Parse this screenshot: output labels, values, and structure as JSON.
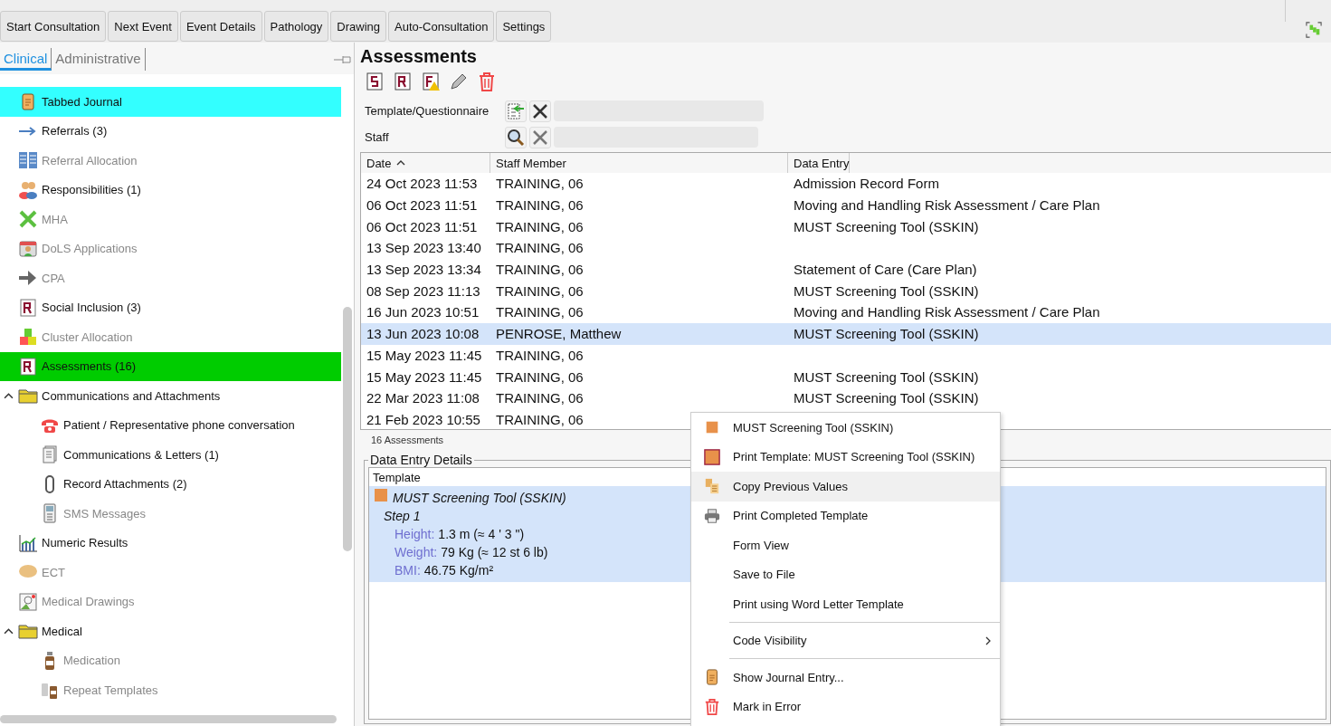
{
  "toolbar": {
    "buttons": [
      "Start Consultation",
      "Next Event",
      "Event Details",
      "Pathology",
      "Drawing",
      "Auto-Consultation",
      "Settings"
    ]
  },
  "sidebar": {
    "tabs": [
      {
        "label": "Clinical",
        "selected": true
      },
      {
        "label": "Administrative",
        "selected": false
      }
    ],
    "items": [
      {
        "label": "Tabbed Journal",
        "disabled": false,
        "color": "#33ffff"
      },
      {
        "label": "Referrals (3)",
        "disabled": false
      },
      {
        "label": "Referral Allocation",
        "disabled": true
      },
      {
        "label": "Responsibilities (1)",
        "disabled": false
      },
      {
        "label": "MHA",
        "disabled": true
      },
      {
        "label": "DoLS Applications",
        "disabled": true
      },
      {
        "label": "CPA",
        "disabled": true
      },
      {
        "label": "Social Inclusion (3)",
        "disabled": false
      },
      {
        "label": "Cluster Allocation",
        "disabled": true
      },
      {
        "label": "Assessments (16)",
        "disabled": false,
        "color": "#00cc00"
      },
      {
        "label": "Communications and Attachments",
        "disabled": false,
        "expanded": true,
        "children": [
          {
            "label": "Patient / Representative phone conversation",
            "disabled": false
          },
          {
            "label": "Communications & Letters (1)",
            "disabled": false
          },
          {
            "label": "Record Attachments (2)",
            "disabled": false
          },
          {
            "label": "SMS Messages",
            "disabled": true
          }
        ]
      },
      {
        "label": "Numeric Results",
        "disabled": false
      },
      {
        "label": "ECT",
        "disabled": true
      },
      {
        "label": "Medical Drawings",
        "disabled": true
      },
      {
        "label": "Medical",
        "disabled": false,
        "expanded": true,
        "children": [
          {
            "label": "Medication",
            "disabled": true
          },
          {
            "label": "Repeat Templates",
            "disabled": true
          }
        ]
      }
    ]
  },
  "main": {
    "title": "Assessments",
    "filters": [
      {
        "label": "Template/Questionnaire",
        "kind": "template"
      },
      {
        "label": "Staff",
        "kind": "search"
      }
    ],
    "table": {
      "columns": [
        {
          "label": "Date",
          "sorted": true
        },
        {
          "label": "Staff Member",
          "sorted": false
        },
        {
          "label": "Data Entry",
          "sorted": false
        }
      ],
      "rows": [
        {
          "date": "24 Oct 2023 11:53",
          "staff": "TRAINING, 06",
          "entry": "Admission Record Form",
          "selected": false
        },
        {
          "date": "06 Oct 2023 11:51",
          "staff": "TRAINING, 06",
          "entry": "Moving and Handling Risk Assessment / Care Plan",
          "selected": false
        },
        {
          "date": "06 Oct 2023 11:51",
          "staff": "TRAINING, 06",
          "entry": "MUST Screening Tool (SSKIN)",
          "selected": false
        },
        {
          "date": "13 Sep 2023 13:40",
          "staff": "TRAINING, 06",
          "selected": false
        },
        {
          "date": "13 Sep 2023 13:34",
          "staff": "TRAINING, 06",
          "entry": "Statement of Care (Care Plan)",
          "selected": false
        },
        {
          "date": "08 Sep 2023 11:13",
          "staff": "TRAINING, 06",
          "entry": "MUST Screening Tool (SSKIN)",
          "selected": false
        },
        {
          "date": "16 Jun 2023 10:51",
          "staff": "TRAINING, 06",
          "entry": "Moving and Handling Risk Assessment / Care Plan",
          "selected": false
        },
        {
          "date": "13 Jun 2023 10:08",
          "staff": "PENROSE, Matthew",
          "entry": "MUST Screening Tool (SSKIN)",
          "selected": true
        },
        {
          "date": "15 May 2023 11:45",
          "staff": "TRAINING, 06",
          "selected": false
        },
        {
          "date": "15 May 2023 11:45",
          "staff": "TRAINING, 06",
          "entry": "MUST Screening Tool (SSKIN)",
          "selected": false
        },
        {
          "date": "22 Mar 2023 11:08",
          "staff": "TRAINING, 06",
          "entry": "MUST Screening Tool (SSKIN)",
          "selected": false
        },
        {
          "date": "21 Feb 2023 10:55",
          "staff": "TRAINING, 06",
          "selected": false
        }
      ],
      "count": "16 Assessments"
    },
    "details": {
      "title": "Data Entry Details",
      "column": "Template",
      "template": "MUST Screening Tool (SSKIN)",
      "step": "Step 1",
      "fields": [
        {
          "label": "Height:",
          "value": "1.3 m  (≈ 4 ' 3 \")"
        },
        {
          "label": "Weight:",
          "value": "79 Kg  (≈ 12 st 6 lb)"
        },
        {
          "label": "BMI:",
          "value": "46.75 Kg/m²"
        }
      ]
    }
  },
  "context_menu": {
    "items": [
      {
        "kind": "item",
        "label": "MUST Screening Tool (SSKIN)",
        "selected": false
      },
      {
        "kind": "item",
        "label": "Print Template: MUST Screening Tool (SSKIN)",
        "selected": false
      },
      {
        "kind": "item",
        "label": "Copy Previous Values",
        "selected": true
      },
      {
        "kind": "item",
        "label": "Print Completed Template",
        "selected": false
      },
      {
        "kind": "item",
        "label": "Form View",
        "selected": false
      },
      {
        "kind": "item",
        "label": "Save to File",
        "selected": false
      },
      {
        "kind": "item",
        "label": "Print using Word Letter Template",
        "selected": false
      },
      {
        "kind": "separator"
      },
      {
        "kind": "item",
        "label": "Code Visibility",
        "submenu": true,
        "selected": false
      },
      {
        "kind": "separator"
      },
      {
        "kind": "item",
        "label": "Show Journal Entry...",
        "selected": false
      },
      {
        "kind": "item",
        "label": "Mark in Error",
        "selected": false
      }
    ]
  }
}
